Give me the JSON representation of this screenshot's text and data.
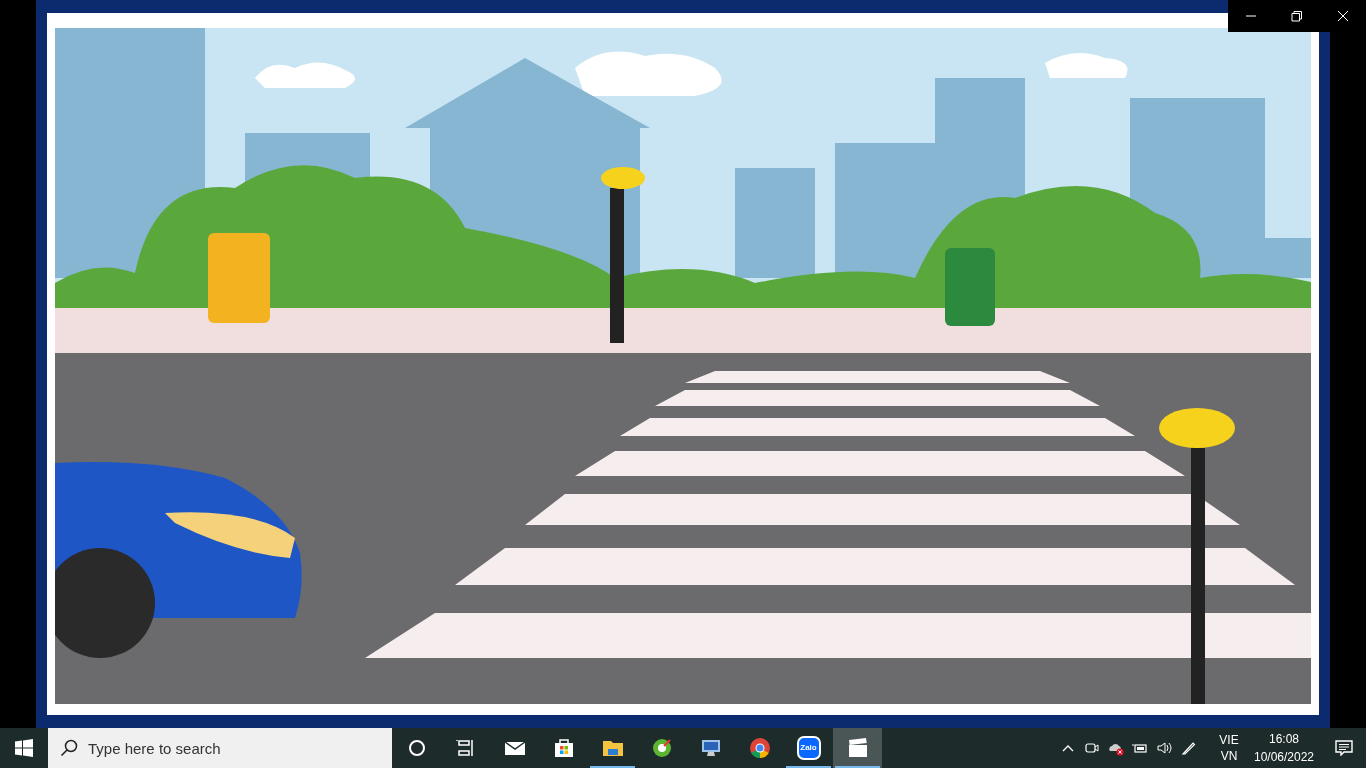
{
  "window": {
    "controls": [
      {
        "kind": "minimize"
      },
      {
        "kind": "restore"
      },
      {
        "kind": "close"
      }
    ]
  },
  "taskbar": {
    "search": {
      "placeholder": "Type here to search"
    },
    "apps": [
      {
        "kind": "cortana",
        "running": false,
        "selected": false
      },
      {
        "kind": "taskview",
        "running": false,
        "selected": false
      },
      {
        "kind": "mail",
        "running": false,
        "selected": false
      },
      {
        "kind": "store",
        "running": false,
        "selected": false
      },
      {
        "kind": "explorer",
        "running": true,
        "selected": false
      },
      {
        "kind": "greenapp",
        "running": false,
        "selected": false
      },
      {
        "kind": "computer",
        "running": false,
        "selected": false
      },
      {
        "kind": "chrome",
        "running": false,
        "selected": false
      },
      {
        "kind": "zalo",
        "label": "Zalo",
        "running": true,
        "selected": false
      },
      {
        "kind": "video",
        "running": true,
        "selected": true
      }
    ],
    "tray": [
      {
        "kind": "chevron"
      },
      {
        "kind": "camera"
      },
      {
        "kind": "cloud"
      },
      {
        "kind": "battery"
      },
      {
        "kind": "volume"
      },
      {
        "kind": "pen"
      }
    ],
    "language": [
      "VIE",
      "VN"
    ],
    "time": "16:08",
    "date": "10/06/2022"
  }
}
